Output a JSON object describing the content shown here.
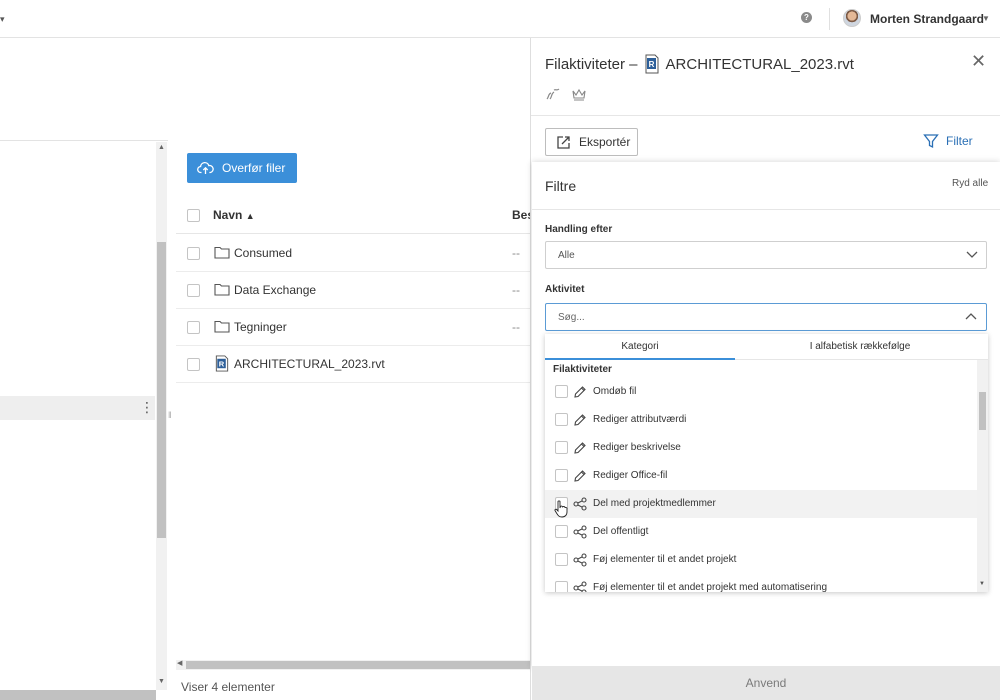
{
  "header": {
    "help_label": "?",
    "user_name": "Morten Strandgaard"
  },
  "toolbar": {
    "upload_label": "Overfør filer"
  },
  "file_list": {
    "columns": {
      "name": "Navn",
      "description": "Beskrivelse"
    },
    "rows": [
      {
        "name": "Consumed",
        "type": "folder",
        "description": "--"
      },
      {
        "name": "Data Exchange",
        "type": "folder",
        "description": "--"
      },
      {
        "name": "Tegninger",
        "type": "folder",
        "description": "--"
      },
      {
        "name": "ARCHITECTURAL_2023.rvt",
        "type": "rvt",
        "description": ""
      }
    ],
    "status": "Viser 4 elementer"
  },
  "side_panel": {
    "title": "Filaktiviteter – ",
    "file_name": "ARCHITECTURAL_2023.rvt",
    "export_label": "Eksportér",
    "filter_label": "Filter",
    "filters": {
      "title": "Filtre",
      "clear_label": "Ryd alle",
      "action_by_label": "Handling efter",
      "action_by_value": "Alle",
      "activity_label": "Aktivitet",
      "search_placeholder": "Søg...",
      "tabs": [
        "Kategori",
        "I alfabetisk rækkefølge"
      ],
      "active_tab": 0,
      "group_title": "Filaktiviteter",
      "items": [
        {
          "label": "Omdøb fil",
          "icon": "pencil-icon",
          "checked": false
        },
        {
          "label": "Rediger attributværdi",
          "icon": "pencil-icon",
          "checked": false
        },
        {
          "label": "Rediger beskrivelse",
          "icon": "pencil-icon",
          "checked": false
        },
        {
          "label": "Rediger Office-fil",
          "icon": "pencil-icon",
          "checked": false
        },
        {
          "label": "Del med projektmedlemmer",
          "icon": "share-icon",
          "checked": false,
          "hovered": true
        },
        {
          "label": "Del offentligt",
          "icon": "share-icon",
          "checked": false
        },
        {
          "label": "Føj elementer til et andet projekt",
          "icon": "share-icon",
          "checked": false
        },
        {
          "label": "Føj elementer til et andet projekt med automatisering",
          "icon": "share-icon",
          "checked": false
        }
      ]
    },
    "apply_label": "Anvend"
  },
  "colors": {
    "accent": "#3b8fd9",
    "link": "#2a6fb5",
    "rvt_badge": "#2d5f99"
  }
}
